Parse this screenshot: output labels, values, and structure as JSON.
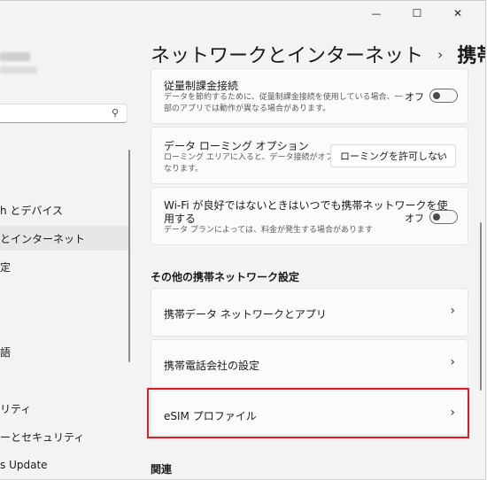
{
  "title_controls": {
    "minimize": "—",
    "maximize": "☐",
    "close": "✕"
  },
  "sidebar": {
    "search_icon": "⚲",
    "items": [
      {
        "label": "h とデバイス",
        "selected": false
      },
      {
        "label": "とインターネット",
        "selected": true
      },
      {
        "label": "定",
        "selected": false
      },
      {
        "label": "語",
        "selected": false
      },
      {
        "label": "リティ",
        "selected": false
      },
      {
        "label": "ーとセキュリティ",
        "selected": false
      },
      {
        "label": "s Update",
        "selected": false
      }
    ]
  },
  "header": {
    "parent": "ネットワークとインターネット",
    "separator": "›",
    "current": "携帯電話"
  },
  "settings": {
    "metered": {
      "title": "従量制課金接続",
      "desc1": "データを節約するために、従量制課金接続を使用している場合、一",
      "desc2": "部のアプリでは動作が異なる場合があります。",
      "toggle_label": "オフ"
    },
    "roaming": {
      "title": "データ ローミング オプション",
      "desc1": "ローミング エリアに入ると、データ接続がオフに",
      "desc2": "なります。",
      "dropdown_value": "ローミングを許可しない",
      "dropdown_icon": "﹀"
    },
    "wifi": {
      "title1": "Wi-Fi が良好ではないときはいつでも携帯ネットワークを使",
      "title2": "用する",
      "desc": "データ プランによっては、料金が発生する場合があります",
      "toggle_label": "オフ"
    }
  },
  "other_section": {
    "title": "その他の携帯ネットワーク設定",
    "items": [
      {
        "label": "携帯データ ネットワークとアプリ",
        "chevron": "›"
      },
      {
        "label": "携帯電話会社の設定",
        "chevron": "›"
      },
      {
        "label": "eSIM プロファイル",
        "chevron": "›"
      }
    ]
  },
  "related_section": {
    "title": "関連"
  }
}
